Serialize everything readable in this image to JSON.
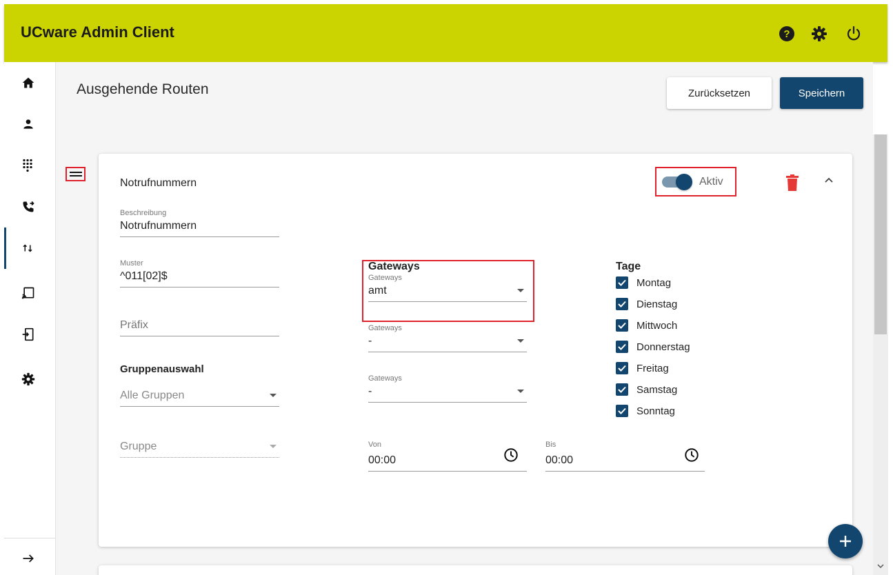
{
  "app": {
    "title": "UCware Admin Client"
  },
  "topbar": {
    "icons": [
      "help-icon",
      "gear-icon",
      "power-icon"
    ]
  },
  "sidebar": {
    "items": [
      {
        "icon": "home-icon",
        "active": false
      },
      {
        "icon": "person-icon",
        "active": false
      },
      {
        "icon": "dialpad-icon",
        "active": false
      },
      {
        "icon": "phone-forward-icon",
        "active": false
      },
      {
        "icon": "routes-icon",
        "active": true
      },
      {
        "icon": "cast-icon",
        "active": false
      },
      {
        "icon": "login-icon",
        "active": false
      },
      {
        "icon": "settings-icon",
        "active": false
      }
    ],
    "expand_icon": "arrow-right-icon"
  },
  "page": {
    "title": "Ausgehende Routen",
    "reset_label": "Zurücksetzen",
    "save_label": "Speichern"
  },
  "route": {
    "title": "Notrufnummern",
    "active_label": "Aktiv",
    "active": true,
    "beschreibung": {
      "label": "Beschreibung",
      "value": "Notrufnummern"
    },
    "muster": {
      "label": "Muster",
      "value": "^011[02]$"
    },
    "praefix": {
      "placeholder": "Präfix"
    },
    "gruppenauswahl": {
      "heading": "Gruppenauswahl",
      "value": "Alle Gruppen"
    },
    "gruppe": {
      "placeholder": "Gruppe"
    },
    "gateways": {
      "heading": "Gateways",
      "items": [
        {
          "label": "Gateways",
          "value": "amt"
        },
        {
          "label": "Gateways",
          "value": "-"
        },
        {
          "label": "Gateways",
          "value": "-"
        }
      ]
    },
    "von": {
      "label": "Von",
      "value": "00:00"
    },
    "bis": {
      "label": "Bis",
      "value": "00:00"
    },
    "tage": {
      "heading": "Tage",
      "days": [
        {
          "label": "Montag",
          "checked": true
        },
        {
          "label": "Dienstag",
          "checked": true
        },
        {
          "label": "Mittwoch",
          "checked": true
        },
        {
          "label": "Donnerstag",
          "checked": true
        },
        {
          "label": "Freitag",
          "checked": true
        },
        {
          "label": "Samstag",
          "checked": true
        },
        {
          "label": "Sonntag",
          "checked": true
        }
      ]
    }
  },
  "colors": {
    "topbar": "#cbd400",
    "primary": "#12466f",
    "highlight": "#e0202a",
    "delete": "#e53935"
  }
}
